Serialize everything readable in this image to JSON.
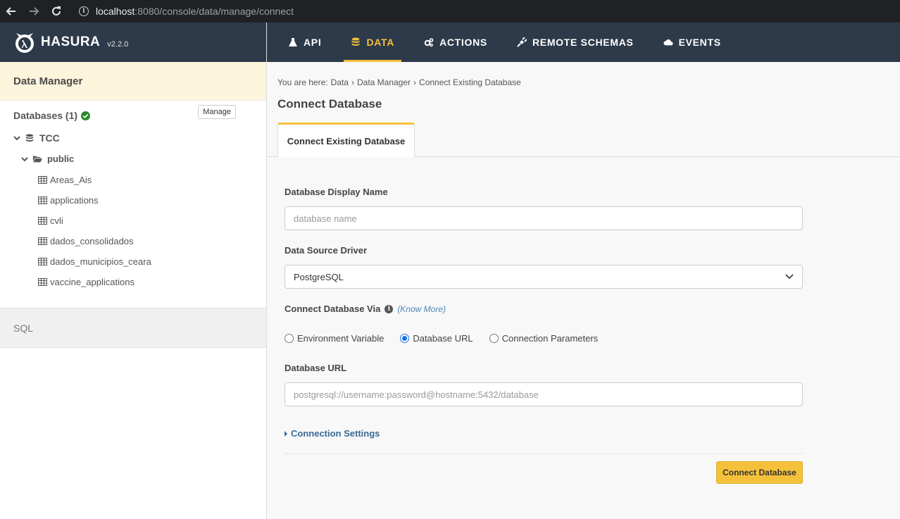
{
  "browser": {
    "url_host": "localhost",
    "url_path": ":8080/console/data/manage/connect"
  },
  "logo": {
    "name": "HASURA",
    "version": "v2.2.0"
  },
  "nav": {
    "items": [
      {
        "label": "API",
        "icon": "flask-icon",
        "active": false
      },
      {
        "label": "DATA",
        "icon": "database-icon",
        "active": true
      },
      {
        "label": "ACTIONS",
        "icon": "cogs-icon",
        "active": false
      },
      {
        "label": "REMOTE SCHEMAS",
        "icon": "plug-icon",
        "active": false
      },
      {
        "label": "EVENTS",
        "icon": "cloud-icon",
        "active": false
      }
    ]
  },
  "sidebar": {
    "header": "Data Manager",
    "databases_label": "Databases (1)",
    "manage_label": "Manage",
    "database": "TCC",
    "schema": "public",
    "tables": [
      "Areas_Ais",
      "applications",
      "cvli",
      "dados_consolidados",
      "dados_municipios_ceara",
      "vaccine_applications"
    ],
    "sql_label": "SQL"
  },
  "main": {
    "breadcrumb": {
      "prefix": "You are here:",
      "items": [
        "Data",
        "Data Manager",
        "Connect Existing Database"
      ]
    },
    "title": "Connect Database",
    "tab": "Connect Existing Database",
    "form": {
      "display_name_label": "Database Display Name",
      "display_name_placeholder": "database name",
      "driver_label": "Data Source Driver",
      "driver_value": "PostgreSQL",
      "via_label": "Connect Database Via",
      "know_more": "(Know More)",
      "radio_options": [
        "Environment Variable",
        "Database URL",
        "Connection Parameters"
      ],
      "radio_selected": "Database URL",
      "url_label": "Database URL",
      "url_placeholder": "postgresql://username:password@hostname:5432/database",
      "connection_settings": "Connection Settings",
      "submit": "Connect Database"
    }
  },
  "colors": {
    "header_bg": "#2d3a4a",
    "accent": "#f5c13b",
    "link": "#3a6b96"
  }
}
